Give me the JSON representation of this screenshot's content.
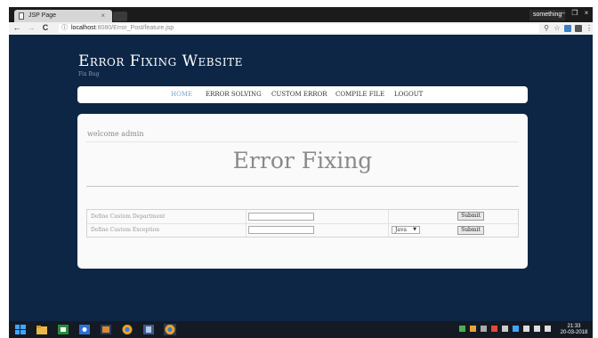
{
  "browser": {
    "tab_title": "JSP Page",
    "tab_close": "×",
    "profile": "something",
    "url_host": "localhost",
    "url_path": ":8080/Error_Post/feature.jsp",
    "back": "←",
    "forward": "→",
    "reload": "C",
    "info": "ⓘ",
    "win_min": "–",
    "win_max": "❐",
    "win_close": "×",
    "zoom_icon": "⚲",
    "star_icon": "☆",
    "menu_icon": "⋮"
  },
  "site": {
    "title": "Error Fixing Website",
    "subtitle": "Fix Bug"
  },
  "nav": {
    "items": [
      {
        "label": "HOME",
        "active": true
      },
      {
        "label": "ERROR SOLVING"
      },
      {
        "label": "CUSTOM ERROR"
      },
      {
        "label": "COMPILE FILE"
      },
      {
        "label": "LOGOUT"
      }
    ]
  },
  "main": {
    "welcome": "welcome admin",
    "heading": "Error Fixing"
  },
  "form": {
    "rows": [
      {
        "label": "Define Custom Department",
        "value": "",
        "button": "Submit"
      },
      {
        "label": "Define Custom Exception",
        "value": "",
        "select": "Java",
        "select_arrow": "▼",
        "button": "Submit"
      }
    ]
  },
  "taskbar": {
    "time": "21:33",
    "date": "20-03-2018"
  },
  "colors": {
    "page_bg": "#0d2646",
    "panel_bg": "#fafafa",
    "nav_active": "#7fa3c0"
  }
}
